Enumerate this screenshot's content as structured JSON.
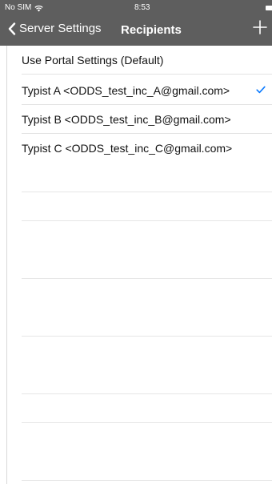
{
  "status_bar": {
    "carrier": "No SIM",
    "time": "8:53",
    "wifi_icon": "wifi-icon",
    "battery_icon": "battery-icon"
  },
  "nav": {
    "back_label": "Server Settings",
    "back_icon": "chevron-left-icon",
    "title": "Recipients",
    "add_icon": "plus-icon"
  },
  "recipients": {
    "items": [
      {
        "label": "Use Portal Settings (Default)",
        "selected": false
      },
      {
        "label": "Typist A <ODDS_test_inc_A@gmail.com>",
        "selected": true
      },
      {
        "label": "Typist B <ODDS_test_inc_B@gmail.com>",
        "selected": false
      },
      {
        "label": "Typist C <ODDS_test_inc_C@gmail.com>",
        "selected": false
      }
    ]
  },
  "colors": {
    "nav_background": "#5e5e5e",
    "accent": "#0a7aff",
    "text": "#111111",
    "separator": "#e2e2e2"
  }
}
